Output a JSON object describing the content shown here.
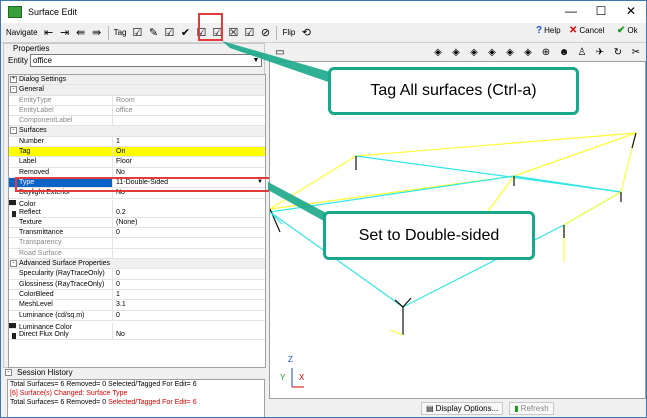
{
  "window": {
    "title": "Surface Edit",
    "minimize": "—",
    "maximize": "☐",
    "close": "✕"
  },
  "toolbar": {
    "navigate_label": "Navigate",
    "tag_label": "Tag",
    "flip_label": "Flip",
    "help_label": "Help",
    "cancel_label": "Cancel",
    "ok_label": "Ok"
  },
  "properties": {
    "group_label": "Properties",
    "entity_label": "Entity",
    "entity_value": "office",
    "rows": [
      {
        "key": "Dialog Settings",
        "value": "",
        "kind": "cat",
        "pm": "+"
      },
      {
        "key": "General",
        "value": "",
        "kind": "cat",
        "pm": "-"
      },
      {
        "key": "EntityType",
        "value": "Room",
        "kind": "grey"
      },
      {
        "key": "EntityLabel",
        "value": "office",
        "kind": "grey"
      },
      {
        "key": "ComponentLabel",
        "value": "",
        "kind": "grey"
      },
      {
        "key": "Surfaces",
        "value": "",
        "kind": "cat",
        "pm": "-"
      },
      {
        "key": "Number",
        "value": "1",
        "kind": "normal"
      },
      {
        "key": "Tag",
        "value": "On",
        "kind": "hl"
      },
      {
        "key": "Label",
        "value": "Floor",
        "kind": "normal"
      },
      {
        "key": "Removed",
        "value": "No",
        "kind": "normal"
      },
      {
        "key": "Type",
        "value": "11-Double-Sided",
        "kind": "sel"
      },
      {
        "key": "Daylight Exterior",
        "value": "No",
        "kind": "normal"
      },
      {
        "key": "Color",
        "value": "&H333333&",
        "kind": "swatch"
      },
      {
        "key": "Reflect",
        "value": "0.2",
        "kind": "normal"
      },
      {
        "key": "Texture",
        "value": "(None)",
        "kind": "normal"
      },
      {
        "key": "Transmittance",
        "value": "0",
        "kind": "normal"
      },
      {
        "key": "Transparency",
        "value": "",
        "kind": "grey"
      },
      {
        "key": "Road Surface",
        "value": "",
        "kind": "grey"
      },
      {
        "key": "Advanced Surface Properties",
        "value": "",
        "kind": "cat",
        "pm": "-"
      },
      {
        "key": "Specularity (RayTraceOnly)",
        "value": "0",
        "kind": "normal"
      },
      {
        "key": "Glossiness (RayTraceOnly)",
        "value": "0",
        "kind": "normal"
      },
      {
        "key": "ColorBleed",
        "value": "1",
        "kind": "normal"
      },
      {
        "key": "MeshLevel",
        "value": "3.1",
        "kind": "normal"
      },
      {
        "key": "Luminance (cd/sq.m)",
        "value": "0",
        "kind": "normal"
      },
      {
        "key": "Luminance Color",
        "value": "&H333333&",
        "kind": "swatch"
      },
      {
        "key": "Direct Flux Only",
        "value": "No",
        "kind": "normal"
      }
    ]
  },
  "history": {
    "title": "Session History",
    "line1": "Total Surfaces= 6 Removed= 0 Selected/Tagged For Edit= 6",
    "line2": "[6] Surface(s) Changed: Surface Type",
    "line3a": "Total Surfaces= 6 Removed= 0 ",
    "line3b": "Selected/Tagged For Edit= 6"
  },
  "view": {
    "display_options": "Display Options...",
    "refresh": "Refresh",
    "axis_z": "Z",
    "axis_y": "Y",
    "axis_x": "X"
  },
  "callouts": {
    "tag_all": "Tag All surfaces (Ctrl-a)",
    "double_sided": "Set to Double-sided"
  },
  "colors": {
    "callout_border": "#1aa88a",
    "highlight_red": "#e33b3b",
    "tag_yellow": "#ffff00",
    "selection_blue": "#0a64c8",
    "wire_yellow": "#ffff33",
    "wire_cyan": "#33e6e6"
  }
}
